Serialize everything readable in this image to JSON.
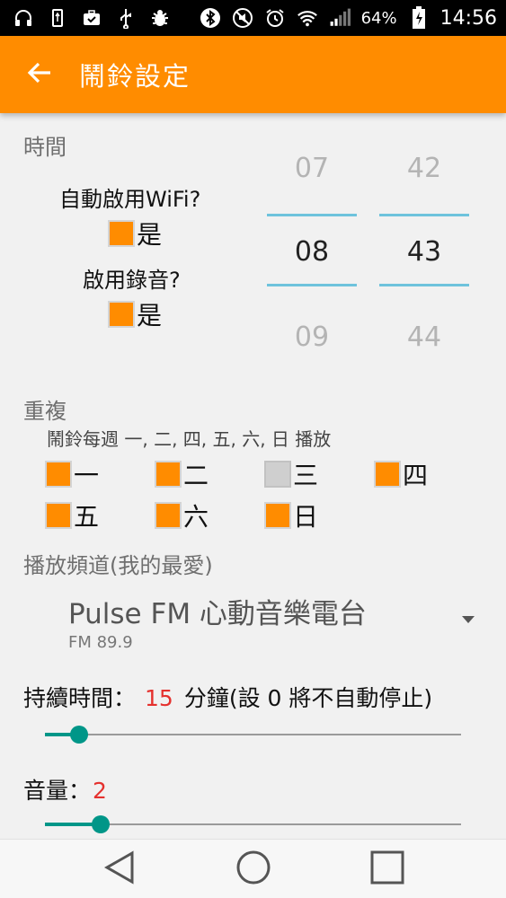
{
  "status_bar": {
    "battery_text": "64%",
    "time": "14:56",
    "icons": [
      "headphones-icon",
      "usb-icon",
      "briefcase-icon",
      "usb-debug-icon",
      "bug-icon",
      "bluetooth-icon",
      "mute-icon",
      "alarm-icon",
      "wifi-icon",
      "signal-icon",
      "battery-charging-icon"
    ]
  },
  "app_bar": {
    "title": "鬧鈴設定",
    "back_icon": "arrow-left-icon",
    "color": "#ff8c00"
  },
  "time_section": {
    "label": "時間",
    "wifi_question": "自動啟用WiFi?",
    "wifi_option": "是",
    "record_question": "啟用錄音?",
    "record_option": "是",
    "hour_picker": {
      "prev": "07",
      "current": "08",
      "next": "09"
    },
    "minute_picker": {
      "prev": "42",
      "current": "43",
      "next": "44"
    }
  },
  "repeat_section": {
    "label": "重複",
    "description": "鬧鈴每週 一, 二, 四, 五, 六, 日 播放",
    "days": [
      {
        "label": "一",
        "checked": true
      },
      {
        "label": "二",
        "checked": true
      },
      {
        "label": "三",
        "checked": false
      },
      {
        "label": "四",
        "checked": true
      },
      {
        "label": "五",
        "checked": true
      },
      {
        "label": "六",
        "checked": true
      },
      {
        "label": "日",
        "checked": true
      }
    ]
  },
  "channel_section": {
    "label": "播放頻道(我的最愛)",
    "selected_title": "Pulse FM 心動音樂電台",
    "selected_sub": "FM 89.9"
  },
  "duration": {
    "label": "持續時間：",
    "value": "15",
    "suffix": "分鐘(設 0 將不自動停止)"
  },
  "volume": {
    "label": "音量：",
    "value": "2"
  },
  "colors": {
    "accent": "#ff8c00",
    "picker_line": "#6ec3dc",
    "slider": "#009688",
    "value_red": "#e5312e"
  }
}
